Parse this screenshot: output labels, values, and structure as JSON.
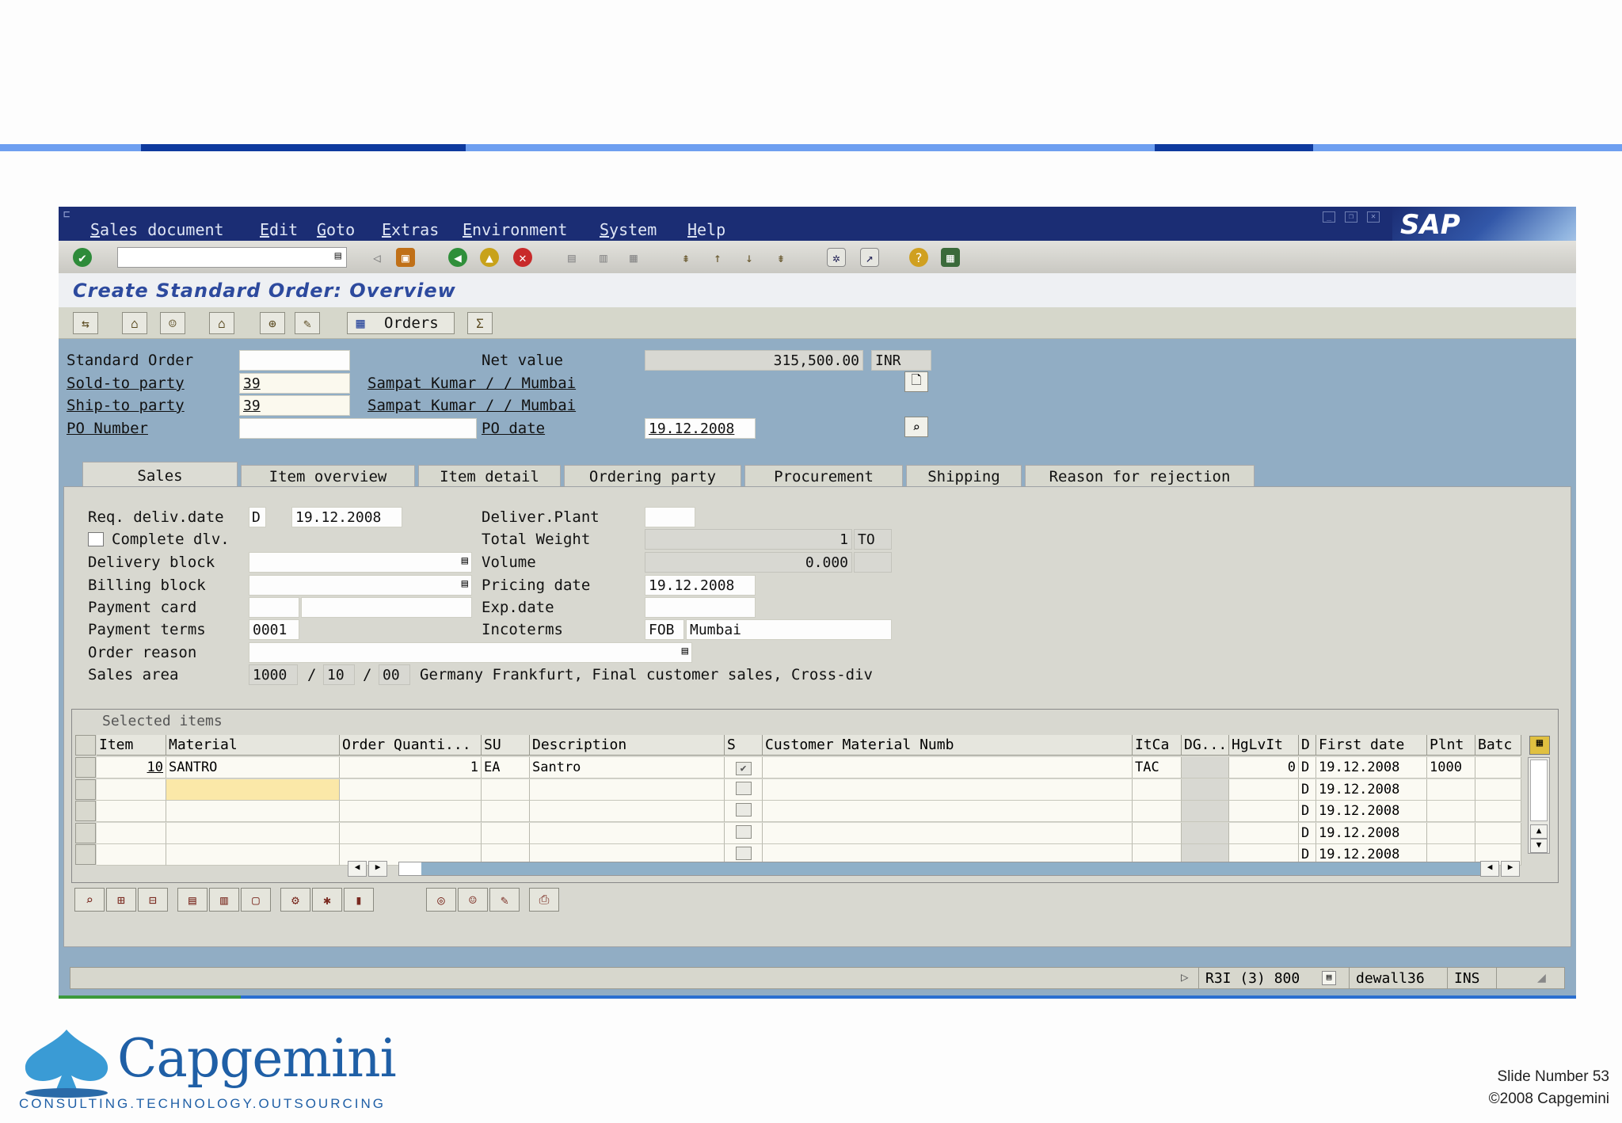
{
  "menu": [
    "Sales document",
    "Edit",
    "Goto",
    "Extras",
    "Environment",
    "System",
    "Help"
  ],
  "sap_logo_text": "SAP",
  "page_title": "Create Standard Order: Overview",
  "apptoolbar": {
    "orders_label": "Orders"
  },
  "header": {
    "standard_order_label": "Standard Order",
    "standard_order_value": "",
    "net_value_label": "Net value",
    "net_value": "315,500.00",
    "currency": "INR",
    "sold_to_label": "Sold-to party",
    "sold_to_value": "39",
    "sold_to_name": "Sampat Kumar / / Mumbai",
    "ship_to_label": "Ship-to party",
    "ship_to_value": "39",
    "ship_to_name": "Sampat Kumar / / Mumbai",
    "po_number_label": "PO Number",
    "po_number_value": "",
    "po_date_label": "PO date",
    "po_date_value": "19.12.2008"
  },
  "tabs": [
    "Sales",
    "Item overview",
    "Item detail",
    "Ordering party",
    "Procurement",
    "Shipping",
    "Reason for rejection"
  ],
  "sales": {
    "req_deliv_label": "Req. deliv.date",
    "req_deliv_type": "D",
    "req_deliv_value": "19.12.2008",
    "complete_dlv_label": "Complete dlv.",
    "delivery_block_label": "Delivery block",
    "billing_block_label": "Billing block",
    "payment_card_label": "Payment card",
    "payment_terms_label": "Payment terms",
    "payment_terms_value": "0001",
    "order_reason_label": "Order reason",
    "sales_area_label": "Sales area",
    "sales_org": "1000",
    "distr_channel": "10",
    "division": "00",
    "sales_area_text": "Germany Frankfurt, Final customer sales, Cross-div",
    "deliver_plant_label": "Deliver.Plant",
    "total_weight_label": "Total Weight",
    "total_weight_value": "1",
    "total_weight_unit": "TO",
    "volume_label": "Volume",
    "volume_value": "0.000",
    "pricing_date_label": "Pricing date",
    "pricing_date_value": "19.12.2008",
    "exp_date_label": "Exp.date",
    "incoterms_label": "Incoterms",
    "incoterms_code": "FOB",
    "incoterms_place": "Mumbai"
  },
  "items": {
    "title": "Selected items",
    "columns": [
      "Item",
      "Material",
      "Order Quanti...",
      "SU",
      "Description",
      "S",
      "Customer Material Numb",
      "ItCa",
      "DG...",
      "HgLvIt",
      "D",
      "First date",
      "Plnt",
      "Batc"
    ],
    "rows": [
      {
        "item": "10",
        "material": "SANTRO",
        "qty": "1",
        "su": "EA",
        "desc": "Santro",
        "itca": "TAC",
        "hglvit": "0",
        "d": "D",
        "first_date": "19.12.2008",
        "plnt": "1000"
      },
      {
        "item": "",
        "material": "",
        "qty": "",
        "su": "",
        "desc": "",
        "itca": "",
        "hglvit": "",
        "d": "D",
        "first_date": "19.12.2008",
        "plnt": ""
      },
      {
        "item": "",
        "material": "",
        "qty": "",
        "su": "",
        "desc": "",
        "itca": "",
        "hglvit": "",
        "d": "D",
        "first_date": "19.12.2008",
        "plnt": ""
      },
      {
        "item": "",
        "material": "",
        "qty": "",
        "su": "",
        "desc": "",
        "itca": "",
        "hglvit": "",
        "d": "D",
        "first_date": "19.12.2008",
        "plnt": ""
      },
      {
        "item": "",
        "material": "",
        "qty": "",
        "su": "",
        "desc": "",
        "itca": "",
        "hglvit": "",
        "d": "D",
        "first_date": "19.12.2008",
        "plnt": ""
      }
    ]
  },
  "status": {
    "system": "R3I (3) 800",
    "user": "dewall36",
    "mode": "INS"
  },
  "footer": {
    "logo_text": "Capgemini",
    "logo_tagline": "CONSULTING.TECHNOLOGY.OUTSOURCING",
    "slide_number": "Slide Number 53",
    "copyright": "©2008 Capgemini"
  },
  "colors": {
    "menubar": "#1b2d74",
    "panel": "#91adc4",
    "title": "#2d4a9e",
    "accent_bar": "#6e9ff0"
  }
}
